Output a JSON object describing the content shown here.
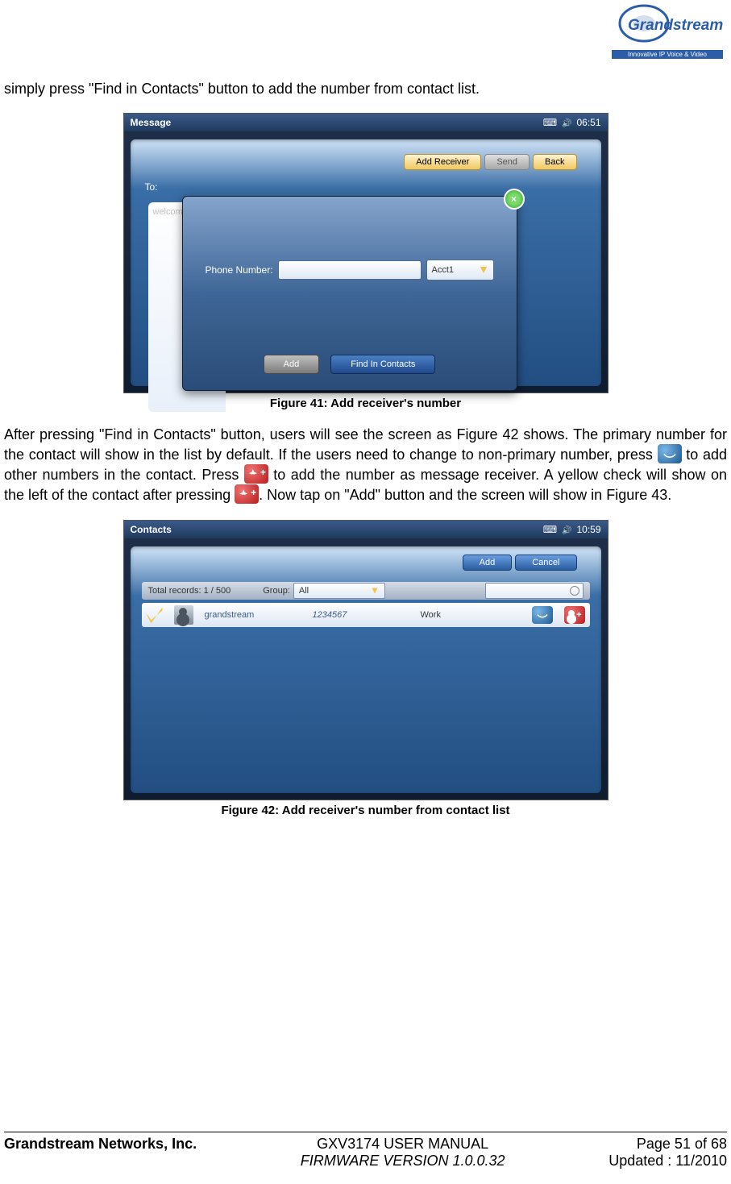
{
  "logo": {
    "line1": "Grandstream",
    "line2": "Innovative IP Voice & Video"
  },
  "para1": "simply press \"Find in Contacts\" button to add the number from contact list.",
  "fig41": {
    "title": "Message",
    "time": "06:51",
    "toolbar": {
      "add_receiver": "Add Receiver",
      "send": "Send",
      "back": "Back"
    },
    "to_label": "To:",
    "textarea_placeholder": "welcom",
    "dialog": {
      "phone_label": "Phone Number:",
      "acct": "Acct1",
      "add_btn": "Add",
      "find_btn": "Find In Contacts"
    },
    "caption": "Figure 41: Add receiver's number"
  },
  "para2": {
    "seg1": "After pressing \"Find in Contacts\" button, users will see the screen as Figure 42 shows. The primary number for the contact will show in the list by default. If the users need to change to non-primary number, press ",
    "seg2": " to add other numbers in the contact. Press ",
    "seg3": " to add the number as message receiver. A yellow check will show on the left of the contact after pressing ",
    "seg4": ". Now tap on \"Add\" button and the screen will show in Figure 43."
  },
  "fig42": {
    "title": "Contacts",
    "time": "10:59",
    "toolbar": {
      "add": "Add",
      "cancel": "Cancel"
    },
    "records_label": "Total records: 1 / 500",
    "group_label": "Group:",
    "group_value": "All",
    "row": {
      "name": "grandstream",
      "number": "1234567",
      "type": "Work"
    },
    "caption": "Figure 42: Add receiver's number from contact list"
  },
  "footer": {
    "company": "Grandstream Networks, Inc.",
    "manual": "GXV3174 USER MANUAL",
    "firmware": "FIRMWARE VERSION 1.0.0.32",
    "page": "Page 51 of 68",
    "updated": "Updated : 11/2010"
  }
}
